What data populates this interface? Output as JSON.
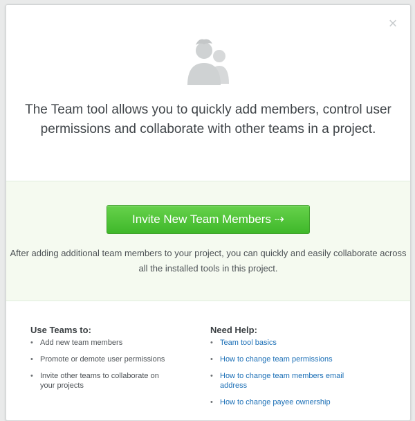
{
  "modal": {
    "close_label": "×",
    "headline": "The Team tool allows you to quickly add members, control user permissions and collaborate with other teams in a project.",
    "cta": {
      "button_label": "Invite New Team Members ⇢",
      "description": "After adding additional team members to your project, you can quickly and easily collaborate across all the installed tools in this project."
    },
    "use_teams": {
      "title": "Use Teams to:",
      "items": [
        "Add new team members",
        "Promote or demote user permissions",
        "Invite other teams to collaborate on your projects"
      ]
    },
    "need_help": {
      "title": "Need Help:",
      "links": [
        "Team tool basics",
        "How to change team permissions",
        "How to change team members email address",
        "How to change payee ownership"
      ]
    }
  },
  "colors": {
    "button_green": "#4cc232",
    "link_blue": "#1b6fb6",
    "band_bg": "#f5faf0"
  },
  "icons": {
    "hero": "team-users-icon",
    "close": "close-icon"
  }
}
